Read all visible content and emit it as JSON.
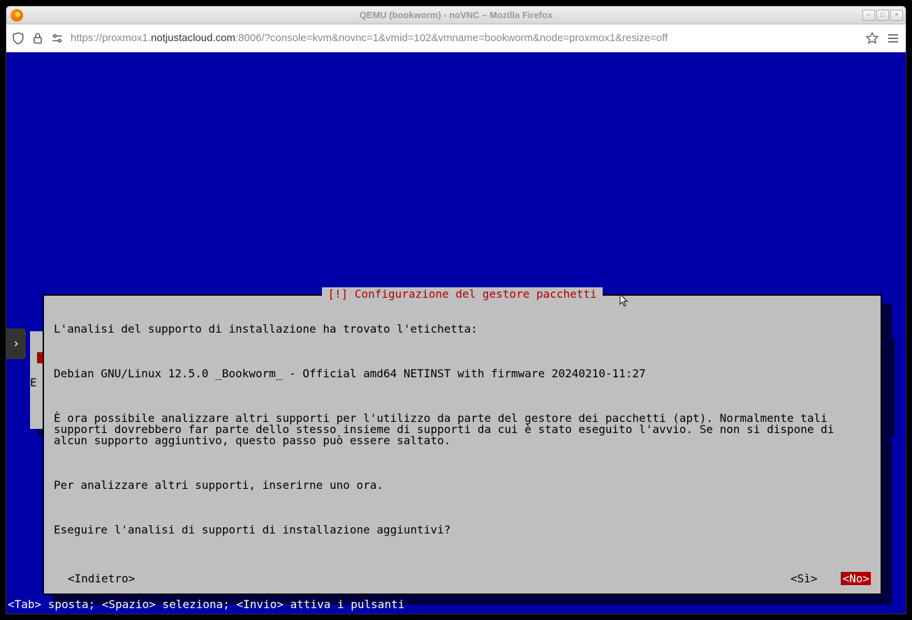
{
  "window": {
    "title": "QEMU (bookworm) - noVNC – Mozilla Firefox"
  },
  "url": {
    "prefix": "https://proxmox1.",
    "domain": "notjustacloud.com",
    "suffix": ":8006/?console=kvm&novnc=1&vmid=102&vmname=bookworm&node=proxmox1&resize=off"
  },
  "dialog": {
    "title": "[!] Configurazione del gestore pacchetti",
    "line1": "L'analisi del supporto di installazione ha trovato l'etichetta:",
    "line2": "Debian GNU/Linux 12.5.0 _Bookworm_ - Official amd64 NETINST with firmware 20240210-11:27",
    "line3": "È ora possibile analizzare altri supporti per l'utilizzo da parte del gestore dei pacchetti (apt). Normalmente tali supporti dovrebbero far parte dello stesso insieme di supporti da cui è stato eseguito l'avvio. Se non si dispone di alcun supporto aggiuntivo, questo passo può essere saltato.",
    "line4": "Per analizzare altri supporti, inserirne uno ora.",
    "line5": "Eseguire l'analisi di supporti di installazione aggiuntivi?",
    "back": "<Indietro>",
    "yes": "<Sì>",
    "no": "<No>"
  },
  "bg_dialog": {
    "letter": "E"
  },
  "helpbar": "<Tab> sposta; <Spazio> seleziona; <Invio> attiva i pulsanti"
}
